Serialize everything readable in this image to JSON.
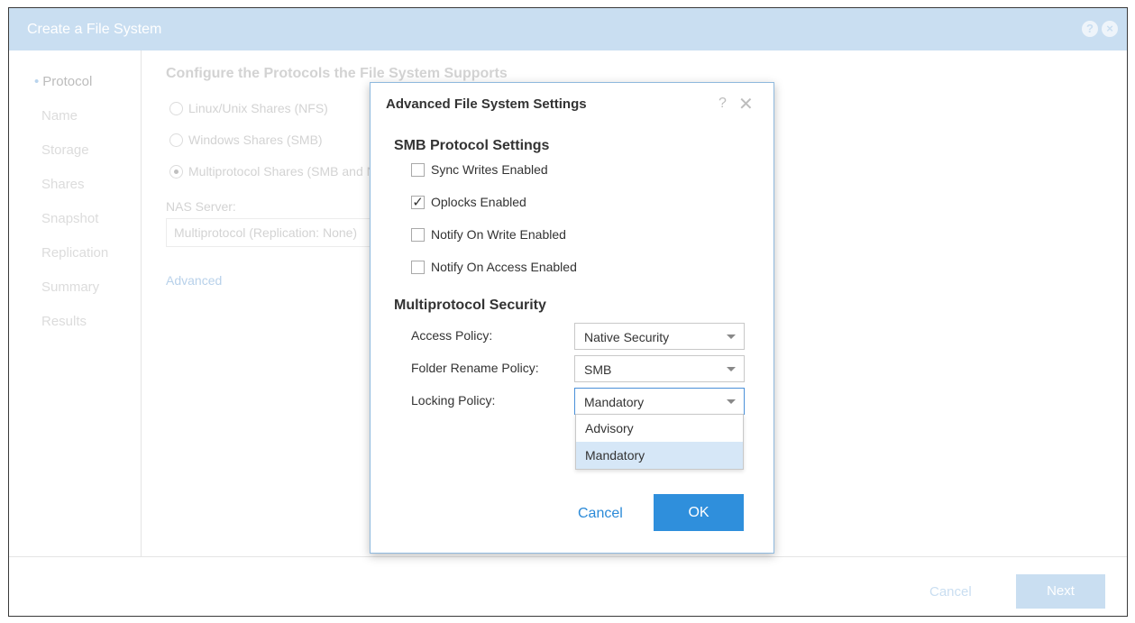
{
  "window": {
    "title": "Create a File System",
    "help_icon": "?",
    "close_icon": "×"
  },
  "sidebar": {
    "items": [
      {
        "label": "Protocol"
      },
      {
        "label": "Name"
      },
      {
        "label": "Storage"
      },
      {
        "label": "Shares"
      },
      {
        "label": "Snapshot"
      },
      {
        "label": "Replication"
      },
      {
        "label": "Summary"
      },
      {
        "label": "Results"
      }
    ]
  },
  "main": {
    "heading": "Configure the Protocols the File System Supports",
    "options": [
      {
        "label": "Linux/Unix Shares (NFS)",
        "checked": false
      },
      {
        "label": "Windows Shares (SMB)",
        "checked": false
      },
      {
        "label": "Multiprotocol Shares (SMB and NFS)",
        "checked": true
      }
    ],
    "nas_label": "NAS Server:",
    "nas_value": "Multiprotocol (Replication: None)",
    "advanced_link": "Advanced"
  },
  "footer": {
    "cancel_label": "Cancel",
    "next_label": "Next"
  },
  "dialog": {
    "title": "Advanced File System Settings",
    "help_icon": "?",
    "close_icon": "✕",
    "smb_section": "SMB Protocol Settings",
    "checkboxes": [
      {
        "label": "Sync Writes Enabled",
        "checked": false,
        "mark": ""
      },
      {
        "label": "Oplocks Enabled",
        "checked": true,
        "mark": "✓"
      },
      {
        "label": "Notify On Write Enabled",
        "checked": false,
        "mark": ""
      },
      {
        "label": "Notify On Access Enabled",
        "checked": false,
        "mark": ""
      }
    ],
    "security_section": "Multiprotocol Security",
    "fields": [
      {
        "label": "Access Policy:",
        "value": "Native Security"
      },
      {
        "label": "Folder Rename Policy:",
        "value": "SMB"
      },
      {
        "label": "Locking Policy:",
        "value": "Mandatory"
      }
    ],
    "locking_options": [
      "Advisory",
      "Mandatory"
    ],
    "locking_selected": "Mandatory",
    "cancel_label": "Cancel",
    "ok_label": "OK"
  },
  "colors": {
    "title_bar": "#c9def1",
    "primary_button": "#2f8fdc",
    "link": "#2b8ad8",
    "selected_option": "#d6e7f7"
  },
  "icons": {
    "title_help": "help-circle-icon",
    "title_close": "close-circle-icon",
    "dialog_help": "help-icon",
    "dialog_close": "close-icon",
    "caret": "chevron-down-icon",
    "check": "checkmark-icon"
  }
}
